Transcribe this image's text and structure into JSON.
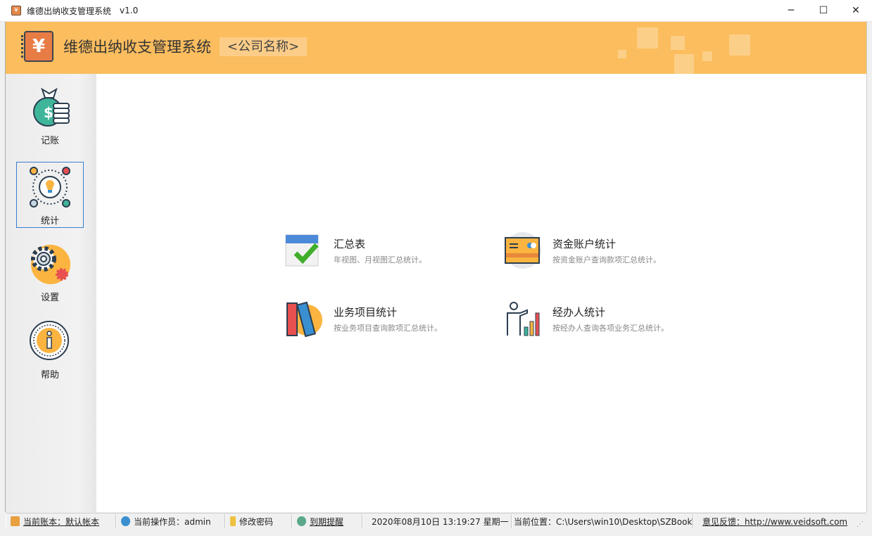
{
  "window": {
    "title": "维德出纳收支管理系统",
    "version": "v1.0",
    "minimize": "─",
    "maximize": "☐",
    "close": "✕"
  },
  "banner": {
    "logo_glyph": "¥",
    "app_name": "维德出纳收支管理系统",
    "company": "<公司名称>"
  },
  "sidebar": {
    "items": [
      {
        "label": "记账"
      },
      {
        "label": "统计",
        "active": true
      },
      {
        "label": "设置"
      },
      {
        "label": "帮助"
      }
    ]
  },
  "cards": [
    {
      "title": "汇总表",
      "desc": "年视图、月视图汇总统计。"
    },
    {
      "title": "资金账户统计",
      "desc": "按资金账户查询款项汇总统计。"
    },
    {
      "title": "业务项目统计",
      "desc": "按业务项目查询款项汇总统计。"
    },
    {
      "title": "经办人统计",
      "desc": "按经办人查询各项业务汇总统计。"
    }
  ],
  "statusbar": {
    "account": "当前账本：默认帐本",
    "operator": "当前操作员：admin",
    "change_password": "修改密码",
    "expiry_reminder": "到期提醒",
    "datetime": "2020年08月10日 13:19:27 星期一",
    "location": "当前位置：C:\\Users\\win10\\Desktop\\SZBook\\",
    "feedback": "意见反馈：http://www.veidsoft.com"
  },
  "colors": {
    "banner": "#fbbd5e",
    "accent": "#3a7fd0"
  }
}
